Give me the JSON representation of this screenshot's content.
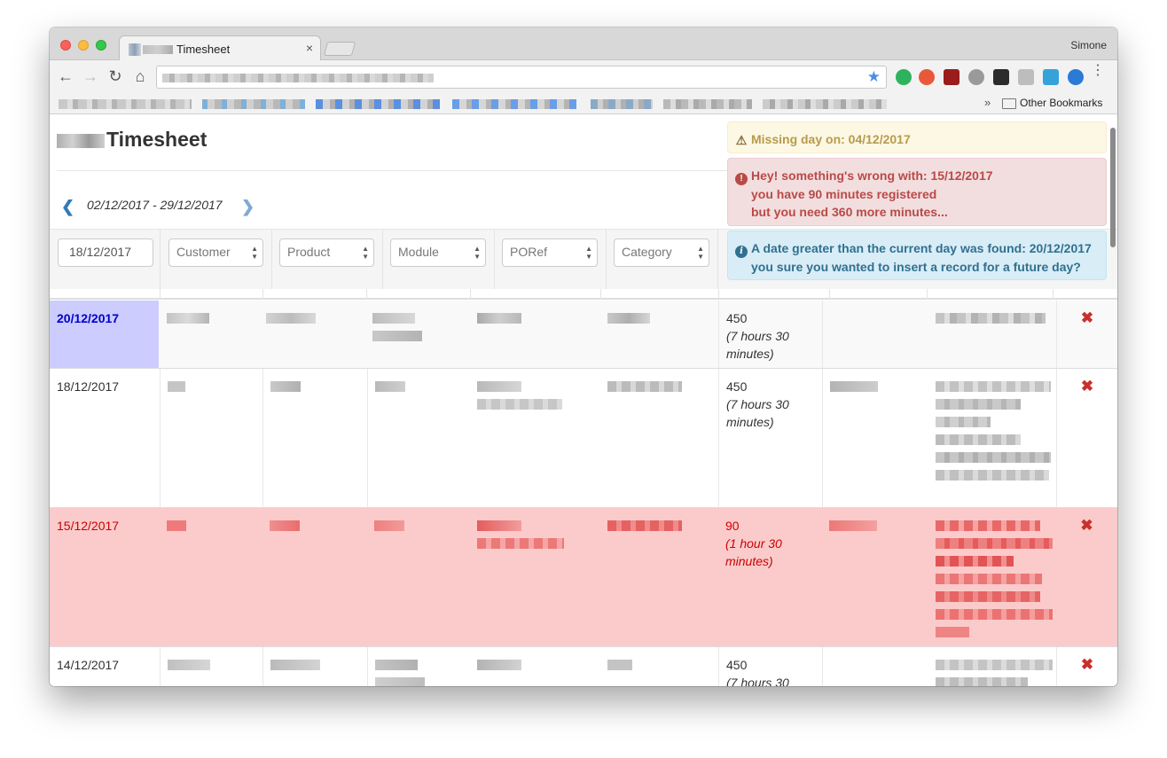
{
  "browser": {
    "tab_title": "Timesheet",
    "tab_close": "×",
    "profile_name": "Simone",
    "bookmarks_more": "»",
    "other_bookmarks": "Other Bookmarks",
    "back": "←",
    "forward": "→",
    "reload": "↻",
    "home": "⌂",
    "star": "★",
    "menu": "⋮"
  },
  "page": {
    "title": "Timesheet",
    "date_range": "02/12/2017 - 29/12/2017",
    "prev_icon": "❮",
    "next_icon": "❯"
  },
  "filters": {
    "date_value": "18/12/2017",
    "customer": "Customer",
    "product": "Product",
    "module": "Module",
    "poref": "PORef",
    "category": "Category"
  },
  "notifications": {
    "warning": "Missing day on: 04/12/2017",
    "error_line1": "Hey! something's wrong with: 15/12/2017",
    "error_line2": "you have 90 minutes registered",
    "error_line3": "but you need 360 more minutes...",
    "info_line1": "A date greater than the current day was found: 20/12/2017",
    "info_line2": "you sure you wanted to insert a record for a future day?",
    "colors": {
      "warning": "#fcf8e3",
      "error": "#f2dede",
      "info": "#d9edf7"
    }
  },
  "rows": [
    {
      "date": "20/12/2017",
      "minutes": "450",
      "duration": "(7 hours 30 minutes)",
      "delete": "✖"
    },
    {
      "date": "18/12/2017",
      "minutes": "450",
      "duration": "(7 hours 30 minutes)",
      "delete": "✖"
    },
    {
      "date": "15/12/2017",
      "minutes": "90",
      "duration": "(1 hour 30 minutes)",
      "delete": "✖"
    },
    {
      "date": "14/12/2017",
      "minutes": "450",
      "duration": "(7 hours 30",
      "delete": "✖"
    }
  ],
  "colors": {
    "future_row_date_bg": "#ccccff",
    "future_row_date_text": "#0000cc",
    "error_row_bg": "#fbcbcb",
    "error_row_text": "#cc0000",
    "accent": "#337ab7"
  }
}
